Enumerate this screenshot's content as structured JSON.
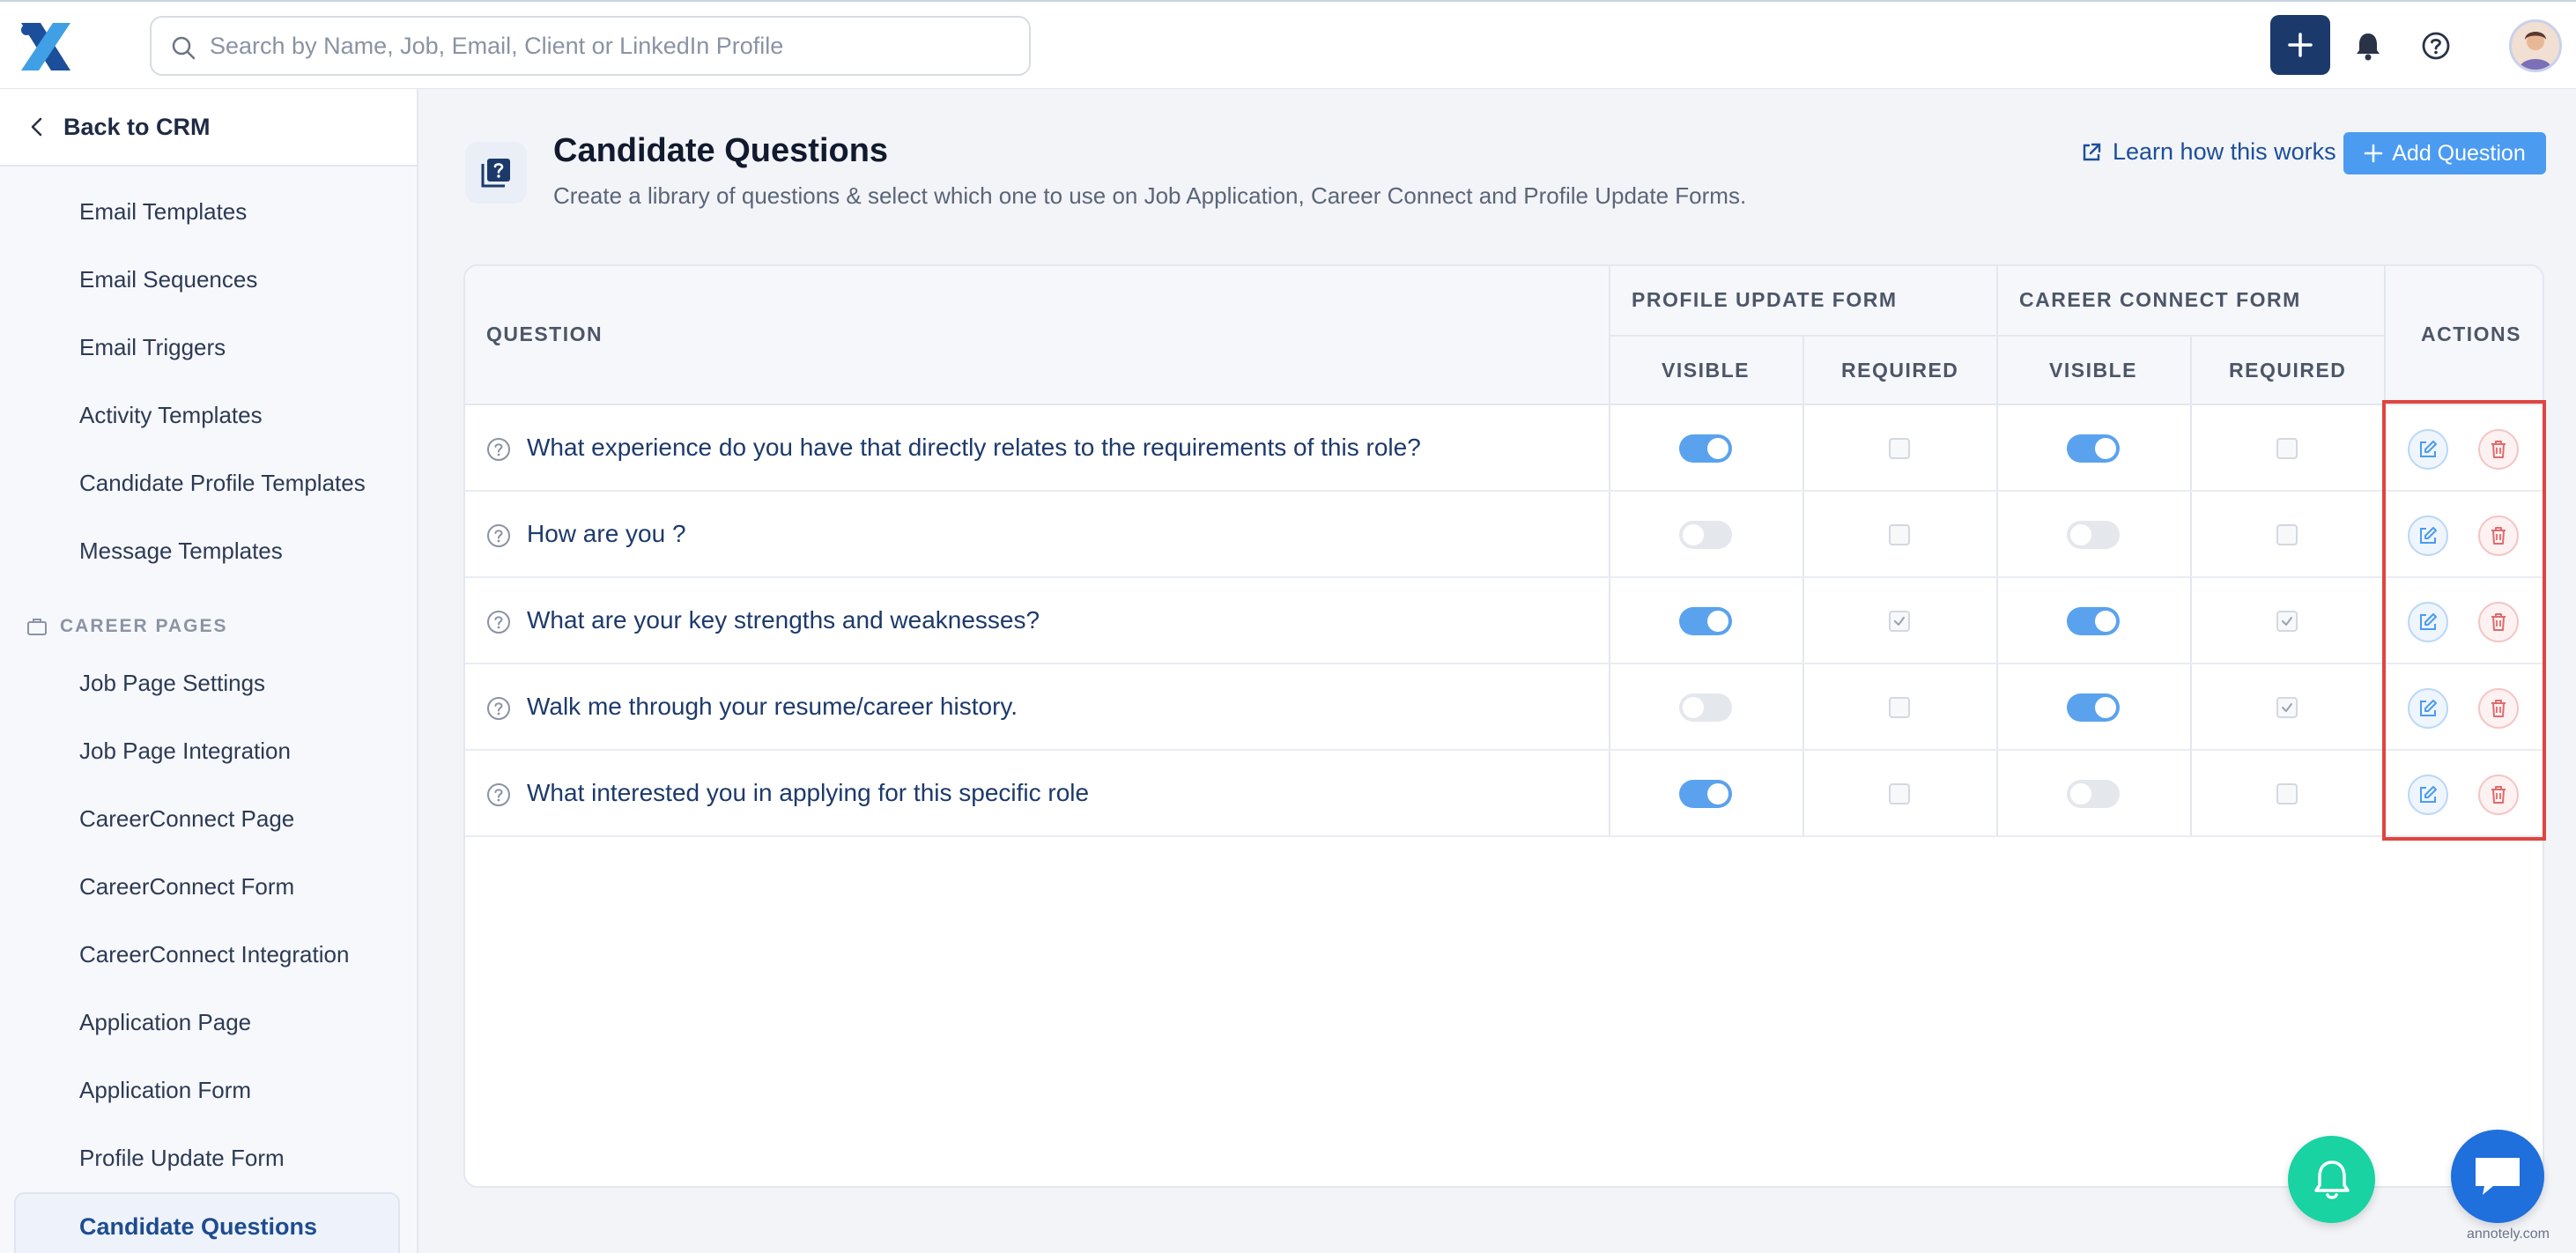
{
  "search": {
    "placeholder": "Search by Name, Job, Email, Client or LinkedIn Profile"
  },
  "sidebar": {
    "back_label": "Back to CRM",
    "items_top": [
      "Email Templates",
      "Email Sequences",
      "Email Triggers",
      "Activity Templates",
      "Candidate Profile Templates",
      "Message Templates"
    ],
    "section_label": "CAREER PAGES",
    "items_career": [
      "Job Page Settings",
      "Job Page Integration",
      "CareerConnect Page",
      "CareerConnect Form",
      "CareerConnect Integration",
      "Application Page",
      "Application Form",
      "Profile Update Form"
    ],
    "active_item": "Candidate Questions"
  },
  "page": {
    "title": "Candidate Questions",
    "subtitle": "Create a library of questions & select which one to use on Job Application, Career Connect and Profile Update Forms.",
    "learn_link": "Learn how this works",
    "add_button": "Add Question"
  },
  "table": {
    "headers": {
      "question": "QUESTION",
      "profile_update_form": "PROFILE UPDATE FORM",
      "career_connect_form": "CAREER CONNECT FORM",
      "visible": "VISIBLE",
      "required": "REQUIRED",
      "actions": "ACTIONS"
    },
    "rows": [
      {
        "question": "What experience do you have that directly relates to the requirements of this role?",
        "pu_visible": true,
        "pu_required": false,
        "cc_visible": true,
        "cc_required": false
      },
      {
        "question": "How are you ?",
        "pu_visible": false,
        "pu_required": false,
        "cc_visible": false,
        "cc_required": false
      },
      {
        "question": "What are your key strengths and weaknesses?",
        "pu_visible": true,
        "pu_required": true,
        "cc_visible": true,
        "cc_required": true
      },
      {
        "question": "Walk me through your resume/career history.",
        "pu_visible": false,
        "pu_required": false,
        "cc_visible": true,
        "cc_required": true
      },
      {
        "question": "What interested you in applying for this specific role",
        "pu_visible": true,
        "pu_required": false,
        "cc_visible": false,
        "cc_required": false
      }
    ]
  },
  "watermark": "annotely.com",
  "colors": {
    "primary_dark": "#1b3a6b",
    "accent_blue": "#4b9bf1",
    "toggle_on": "#5aa2ee",
    "highlight_red": "#e0453f",
    "float_green": "#19d3a2"
  }
}
